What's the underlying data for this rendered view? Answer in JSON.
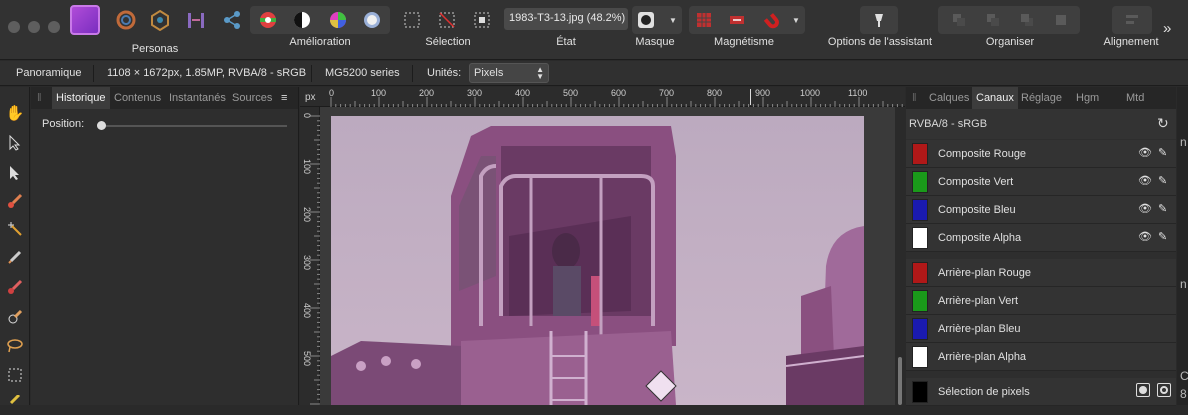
{
  "toolbar": {
    "groups": [
      {
        "label": "Personas"
      },
      {
        "label": "Amélioration"
      },
      {
        "label": "Sélection"
      },
      {
        "label": "État"
      },
      {
        "label": "Masque"
      },
      {
        "label": "Magnétisme"
      },
      {
        "label": "Options de l'assistant"
      },
      {
        "label": "Organiser"
      },
      {
        "label": "Alignement"
      }
    ],
    "document_title": "1983-T3-13.jpg (48.2%)",
    "more": "»"
  },
  "context": {
    "mode": "Panoramique",
    "doc_info": "1108 × 1672px, 1.85MP, RVBA/8 - sRGB",
    "printer": "MG5200 series",
    "units_label": "Unités:",
    "units_value": "Pixels"
  },
  "left_panel": {
    "tabs": [
      "Historique",
      "Contenus",
      "Instantanés",
      "Sources"
    ],
    "position_label": "Position:"
  },
  "ruler": {
    "unit": "px",
    "h_ticks": [
      "0",
      "100",
      "200",
      "300",
      "400",
      "500",
      "600",
      "700",
      "800",
      "900",
      "1000",
      "1100"
    ],
    "v_ticks": [
      "0",
      "100",
      "200",
      "300",
      "400",
      "500"
    ]
  },
  "right_panel": {
    "tabs": [
      "Calques",
      "Canaux",
      "Réglage",
      "Hgm",
      "Mtd"
    ],
    "color_space": "RVBA/8 - sRGB",
    "channels": [
      {
        "name": "Composite Rouge",
        "color": "#b01818"
      },
      {
        "name": "Composite Vert",
        "color": "#1a9a1a"
      },
      {
        "name": "Composite Bleu",
        "color": "#1a1ab0"
      },
      {
        "name": "Composite Alpha",
        "color": "#ffffff"
      },
      {
        "name": "Arrière-plan Rouge",
        "color": "#b01818"
      },
      {
        "name": "Arrière-plan Vert",
        "color": "#1a9a1a"
      },
      {
        "name": "Arrière-plan Bleu",
        "color": "#1a1ab0"
      },
      {
        "name": "Arrière-plan Alpha",
        "color": "#ffffff"
      },
      {
        "name": "Sélection de pixels",
        "color": "#000000"
      }
    ]
  },
  "edge_text": [
    "n",
    "n",
    "C",
    "8"
  ]
}
